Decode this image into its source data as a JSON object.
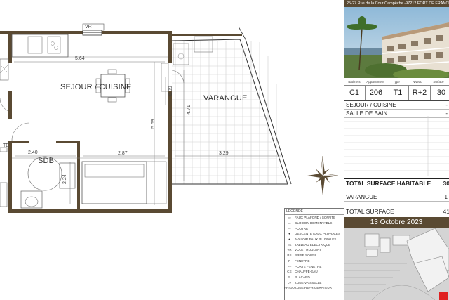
{
  "plan": {
    "rooms": {
      "sejour": "SEJOUR / CUISINE",
      "varangue": "VARANGUE",
      "sdb": "SDB",
      "te": "TE",
      "vr": "VR"
    },
    "dims": {
      "d1": "5.64",
      "d2": "5.69",
      "d3": "4.71",
      "d4": "2.87",
      "d5": "3.29",
      "d6": "2.40",
      "d7": "2.24",
      "d8": "0.99"
    }
  },
  "legend": {
    "title": "LEGENDE",
    "items": [
      {
        "sym": "▭",
        "label": "FAUX PLAFOND / SOFFITE"
      },
      {
        "sym": "▭",
        "label": "CLOISON DEMONTABLE"
      },
      {
        "sym": "▭",
        "label": "POUTRE"
      },
      {
        "sym": "●",
        "label": "DESCENTE EAUX PLUVIALES"
      },
      {
        "sym": "●",
        "label": "AVALOIR EAUX PLUVIALES"
      },
      {
        "sym": "TE",
        "label": "TABLEAU ELECTRIQUE"
      },
      {
        "sym": "VR",
        "label": "VOLET ROULANT"
      },
      {
        "sym": "BS",
        "label": "BRISE SOLEIL"
      },
      {
        "sym": "F",
        "label": "FENETRE"
      },
      {
        "sym": "PF",
        "label": "PORTE FENETRE"
      },
      {
        "sym": "CE",
        "label": "CHAUFFE-EAU"
      },
      {
        "sym": "PL",
        "label": "PLACARD"
      },
      {
        "sym": "LV",
        "label": "ZONE VAISSELLE"
      },
      {
        "sym": "FRIGO",
        "label": "ZONE REFRIGERATEUR"
      }
    ]
  },
  "panel": {
    "address": "25-27 Rue de la Cour Campêche -97212 FORT DE FRANCE",
    "headers": [
      "Bâtiment",
      "Appartement",
      "Type",
      "Niveau",
      "Surface"
    ],
    "values": [
      "C1",
      "206",
      "T1",
      "R+2",
      "30"
    ],
    "rows": [
      {
        "label": "SEJOUR / CUISINE",
        "value": "-"
      },
      {
        "label": "SALLE DE BAIN",
        "value": "-"
      }
    ],
    "total_habitable": "TOTAL SURFACE HABITABLE",
    "total_habitable_value": "30",
    "varangue": "VARANGUE",
    "varangue_value": "1",
    "total_surface": "TOTAL SURFACE",
    "total_surface_value": "41",
    "date": "13 Octobre 2023"
  },
  "colors": {
    "wall": "#5a4a33",
    "accent": "#e02020"
  }
}
